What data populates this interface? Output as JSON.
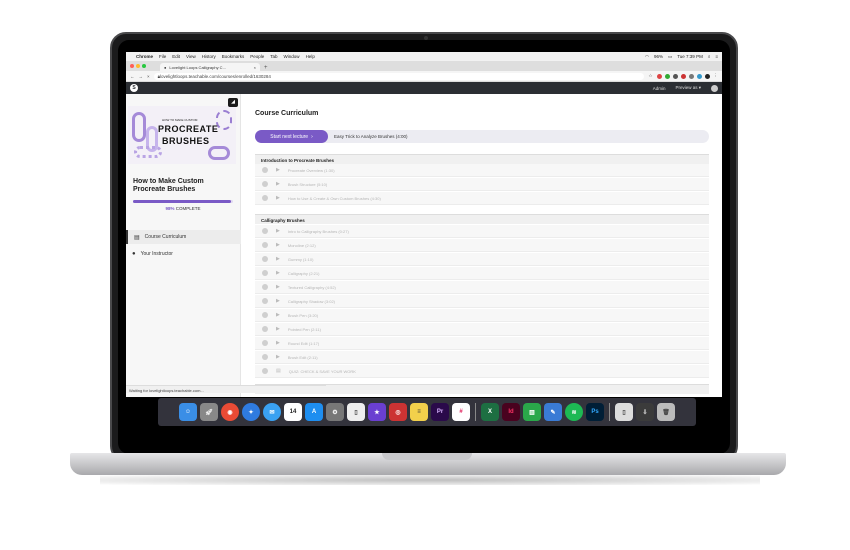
{
  "menubar": {
    "app": "Chrome",
    "items": [
      "File",
      "Edit",
      "View",
      "History",
      "Bookmarks",
      "People",
      "Tab",
      "Window",
      "Help"
    ],
    "battery": "96%",
    "clock": "Tue 7:39 PM"
  },
  "browser": {
    "tab_title": "Lovelight Loops Calligraphy C...",
    "url": "lovelightloops.teachable.com/courses/enrolled/1630284"
  },
  "site": {
    "nav_admin": "Admin",
    "nav_preview": "Preview as ▾"
  },
  "sidebar": {
    "thumb_small": "HOW TO MAKE CUSTOM",
    "thumb_line1": "PROCREATE",
    "thumb_line2": "BRUSHES",
    "course_title": "How to Make Custom Procreate Brushes",
    "progress_percent": "98%",
    "progress_label": "COMPLETE",
    "progress_value": 0.98,
    "nav": [
      {
        "label": "Course Curriculum",
        "icon": "book-icon"
      },
      {
        "label": "Your Instructor",
        "icon": "person-icon"
      }
    ],
    "status": "Waiting for lovelightloops.teachable.com..."
  },
  "main": {
    "title": "Course Curriculum",
    "next_button": "Start next lecture",
    "next_lecture": "Easy Trick to Analyze Brushes (4:00)",
    "sections": [
      {
        "title": "Introduction to Procreate Brushes",
        "lectures": [
          "Procreate Overview (1:30)",
          "Brush Structure (5:10)",
          "How to Use & Create & Own Custom Brushes (4:30)"
        ]
      },
      {
        "title": "Calligraphy Brushes",
        "lectures": [
          "Intro to Calligraphy Brushes (0:27)",
          "Monoline (2:12)",
          "Gummy (1:10)",
          "Calligraphy (2:21)",
          "Textured Calligraphy (4:52)",
          "Calligraphy Shadow (3:02)",
          "Brush Pen (3:20)",
          "Pointed Pen (2:11)",
          "Round Edit (1:17)",
          "Brush Edit (2:11)",
          "QUIZ: CHECK & SAVE YOUR WORK"
        ]
      }
    ]
  },
  "dock": {
    "calendar_day": "14",
    "apps": [
      "Finder",
      "Launchpad",
      "Chrome",
      "Safari",
      "Messages",
      "Calendar",
      "App Store",
      "Preferences",
      "Preview",
      "iMovie",
      "Photo Booth",
      "Notes",
      "Premiere",
      "Slack",
      "Excel",
      "InDesign",
      "Numbers",
      "Pages",
      "Spotify",
      "Photoshop",
      "Documents",
      "Downloads",
      "Trash"
    ]
  }
}
